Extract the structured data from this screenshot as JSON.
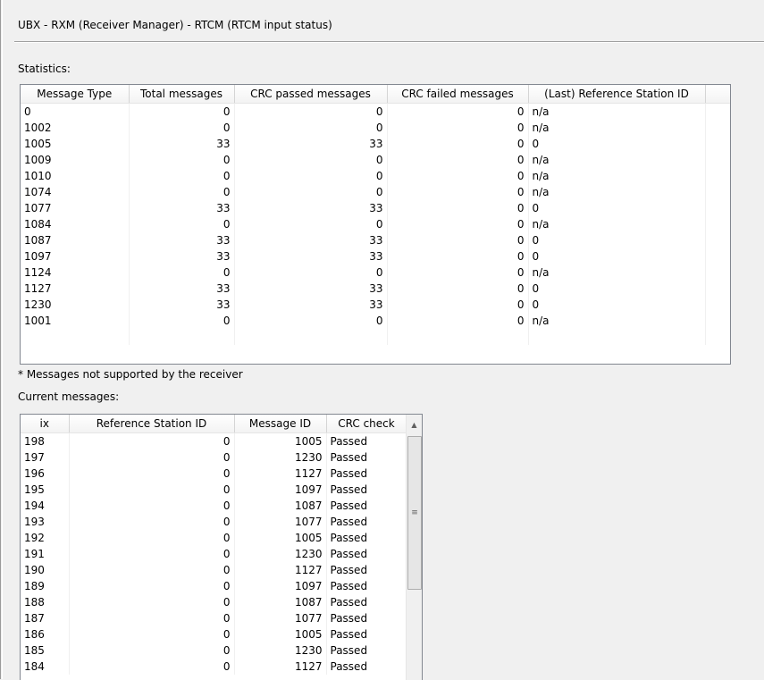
{
  "header": {
    "title": "UBX - RXM (Receiver Manager) - RTCM (RTCM input status)"
  },
  "statistics": {
    "label": "Statistics:",
    "columns": [
      "Message Type",
      "Total messages",
      "CRC passed messages",
      "CRC failed messages",
      "(Last) Reference Station ID"
    ],
    "rows": [
      [
        "0",
        "0",
        "0",
        "0",
        "n/a"
      ],
      [
        "1002",
        "0",
        "0",
        "0",
        "n/a"
      ],
      [
        "1005",
        "33",
        "33",
        "0",
        "0"
      ],
      [
        "1009",
        "0",
        "0",
        "0",
        "n/a"
      ],
      [
        "1010",
        "0",
        "0",
        "0",
        "n/a"
      ],
      [
        "1074",
        "0",
        "0",
        "0",
        "n/a"
      ],
      [
        "1077",
        "33",
        "33",
        "0",
        "0"
      ],
      [
        "1084",
        "0",
        "0",
        "0",
        "n/a"
      ],
      [
        "1087",
        "33",
        "33",
        "0",
        "0"
      ],
      [
        "1097",
        "33",
        "33",
        "0",
        "0"
      ],
      [
        "1124",
        "0",
        "0",
        "0",
        "n/a"
      ],
      [
        "1127",
        "33",
        "33",
        "0",
        "0"
      ],
      [
        "1230",
        "33",
        "33",
        "0",
        "0"
      ],
      [
        "1001",
        "0",
        "0",
        "0",
        "n/a"
      ]
    ]
  },
  "footnote": "* Messages not supported by the receiver",
  "current": {
    "label": "Current messages:",
    "columns": [
      "ix",
      "Reference Station ID",
      "Message ID",
      "CRC check"
    ],
    "rows": [
      [
        "198",
        "0",
        "1005",
        "Passed"
      ],
      [
        "197",
        "0",
        "1230",
        "Passed"
      ],
      [
        "196",
        "0",
        "1127",
        "Passed"
      ],
      [
        "195",
        "0",
        "1097",
        "Passed"
      ],
      [
        "194",
        "0",
        "1087",
        "Passed"
      ],
      [
        "193",
        "0",
        "1077",
        "Passed"
      ],
      [
        "192",
        "0",
        "1005",
        "Passed"
      ],
      [
        "191",
        "0",
        "1230",
        "Passed"
      ],
      [
        "190",
        "0",
        "1127",
        "Passed"
      ],
      [
        "189",
        "0",
        "1097",
        "Passed"
      ],
      [
        "188",
        "0",
        "1087",
        "Passed"
      ],
      [
        "187",
        "0",
        "1077",
        "Passed"
      ],
      [
        "186",
        "0",
        "1005",
        "Passed"
      ],
      [
        "185",
        "0",
        "1230",
        "Passed"
      ],
      [
        "184",
        "0",
        "1127",
        "Passed"
      ]
    ]
  }
}
